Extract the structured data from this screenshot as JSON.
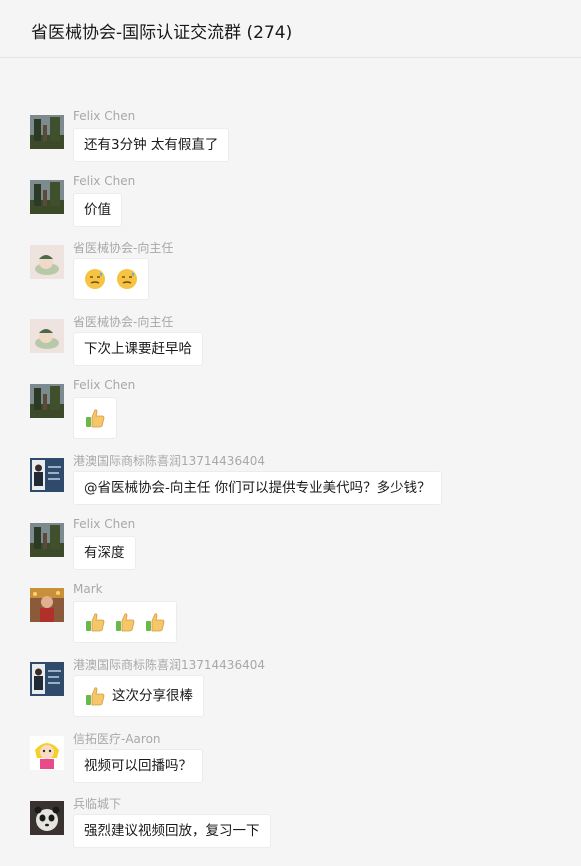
{
  "header": {
    "title": "省医械协会-国际认证交流群 (274)"
  },
  "messages": [
    {
      "sender": "Felix Chen",
      "text": "还有3分钟 太有假直了",
      "avatar": "tree-photo-avatar"
    },
    {
      "sender": "Felix Chen",
      "text": "价值",
      "avatar": "tree-photo-avatar"
    },
    {
      "sender": "省医械协会-向主任",
      "emoji": [
        "sleepy-face-emoji",
        "sleepy-face-emoji"
      ],
      "avatar": "cartoon-avatar"
    },
    {
      "sender": "省医械协会-向主任",
      "text": "下次上课要赶早哈",
      "avatar": "cartoon-avatar"
    },
    {
      "sender": "Felix Chen",
      "emoji": [
        "thumbs-up-emoji"
      ],
      "avatar": "tree-photo-avatar"
    },
    {
      "sender": "港澳国际商标陈喜润13714436404",
      "text": "@省医械协会-向主任 你们可以提供专业美代吗？多少钱？",
      "avatar": "business-card-avatar"
    },
    {
      "sender": "Felix Chen",
      "text": "有深度",
      "avatar": "tree-photo-avatar"
    },
    {
      "sender": "Mark",
      "emoji": [
        "thumbs-up-emoji",
        "thumbs-up-emoji",
        "thumbs-up-emoji"
      ],
      "avatar": "photo-avatar"
    },
    {
      "sender": "港澳国际商标陈喜润13714436404",
      "emoji": [
        "thumbs-up-emoji"
      ],
      "text": "这次分享很棒",
      "avatar": "business-card-avatar"
    },
    {
      "sender": "信拓医疗-Aaron",
      "text": "视频可以回播吗？",
      "avatar": "cartoon-girl-avatar"
    },
    {
      "sender": "兵临城下",
      "text": "强烈建议视频回放，复习一下",
      "avatar": "panda-avatar"
    }
  ]
}
